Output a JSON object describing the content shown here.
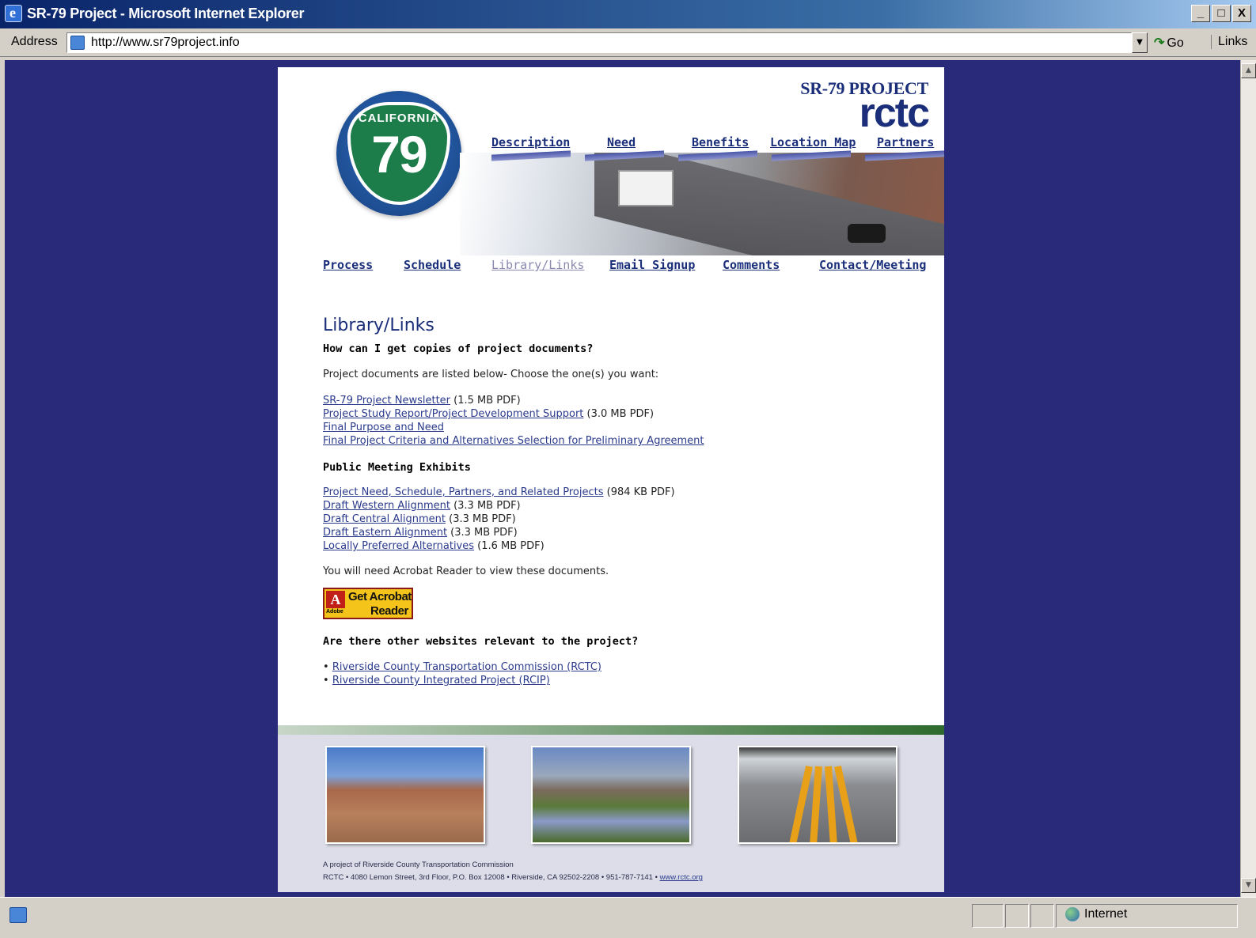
{
  "window": {
    "title": "SR-79 Project - Microsoft Internet Explorer",
    "min_label": "_",
    "max_label": "□",
    "close_label": "X"
  },
  "addressbar": {
    "label": "Address",
    "url": "http://www.sr79project.info",
    "go_label": "Go",
    "links_label": "Links"
  },
  "header": {
    "shield_state": "CALIFORNIA",
    "shield_number": "79",
    "brand_top": "SR-79 PROJECT",
    "brand_logo": "rctc"
  },
  "nav": {
    "tabs": [
      "Description",
      "Need",
      "Benefits",
      "Location Map",
      "Partners"
    ]
  },
  "subnav": {
    "items": [
      "Process",
      "Schedule",
      "Library/Links",
      "Email Signup",
      "Comments",
      "Contact/Meeting"
    ],
    "active": "Library/Links"
  },
  "content": {
    "heading": "Library/Links",
    "q1": "How can I get copies of project documents?",
    "intro": "Project documents are listed below- Choose the one(s) you want:",
    "documents": [
      {
        "link": "SR-79 Project Newsletter",
        "size": " (1.5 MB PDF)"
      },
      {
        "link": "Project Study Report/Project Development Support",
        "size": " (3.0 MB PDF)"
      },
      {
        "link": "Final Purpose and Need",
        "size": ""
      },
      {
        "link": "Final Project Criteria and Alternatives Selection for Preliminary Agreement",
        "size": ""
      }
    ],
    "exhibits_heading": "Public Meeting Exhibits",
    "exhibits": [
      {
        "link": "Project Need, Schedule, Partners, and Related Projects",
        "size": " (984 KB PDF)"
      },
      {
        "link": "Draft Western Alignment",
        "size": " (3.3 MB PDF)"
      },
      {
        "link": "Draft Central Alignment",
        "size": " (3.3 MB PDF)"
      },
      {
        "link": "Draft Eastern Alignment",
        "size": " (3.3 MB PDF)"
      },
      {
        "link": "Locally Preferred Alternatives",
        "size": " (1.6 MB PDF)"
      }
    ],
    "acrobat_note": "You will need Acrobat Reader to view these documents.",
    "acrobat_badge": {
      "get": "Get Acrobat",
      "reader": "Reader",
      "adobe": "Adobe"
    },
    "q2": "Are there other websites relevant to the project?",
    "websites": [
      "Riverside County Transportation Commission (RCTC)",
      "Riverside County Integrated Project (RCIP)"
    ]
  },
  "footer": {
    "line1": "A project of Riverside County Transportation Commission",
    "line2": "RCTC • 4080 Lemon Street, 3rd Floor, P.O. Box 12008 • Riverside, CA 92502-2208 • 951-787-7141 • ",
    "link": "www.rctc.org"
  },
  "statusbar": {
    "zone": "Internet"
  },
  "colors": {
    "viewport_bg": "#2a2a7a",
    "link": "#2a3a8c",
    "brand": "#1a2e7a"
  }
}
